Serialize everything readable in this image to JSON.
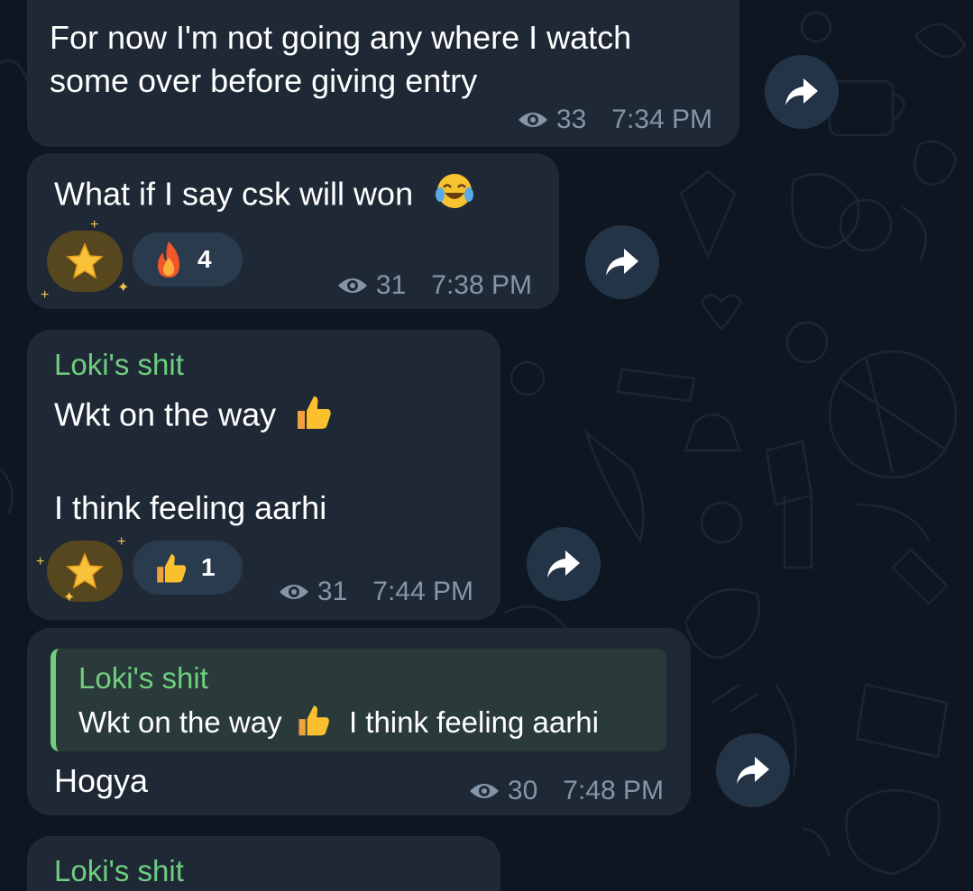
{
  "colors": {
    "background": "#0e1621",
    "bubble": "#1f2936",
    "sender_name": "#6fcf7f",
    "meta_text": "#8495a8",
    "forward_button": "#243447",
    "reaction_pill": "#2b3b4e",
    "star_reaction": "#57471e"
  },
  "messages": [
    {
      "line1": "For now I'm not going any where I watch",
      "line2": "some over before giving entry",
      "views": "33",
      "time": "7:34 PM"
    },
    {
      "text": "What if I say csk will won",
      "emoji": "face-with-tears-of-joy-icon",
      "reactions": [
        {
          "icon": "star-icon"
        },
        {
          "icon": "fire-icon",
          "count": "4"
        }
      ],
      "views": "31",
      "time": "7:38 PM"
    },
    {
      "sender": "Loki's shit",
      "line1": "Wkt on the way",
      "line2": "I think feeling aarhi",
      "emoji": "thumbs-up-icon",
      "reactions": [
        {
          "icon": "star-icon"
        },
        {
          "icon": "thumbs-up-icon",
          "count": "1"
        }
      ],
      "views": "31",
      "time": "7:44 PM"
    },
    {
      "reply": {
        "sender": "Loki's shit",
        "text_a": "Wkt on the way",
        "text_b": "I think feeling aarhi"
      },
      "text": "Hogya",
      "views": "30",
      "time": "7:48 PM"
    },
    {
      "sender": "Loki's shit"
    }
  ]
}
